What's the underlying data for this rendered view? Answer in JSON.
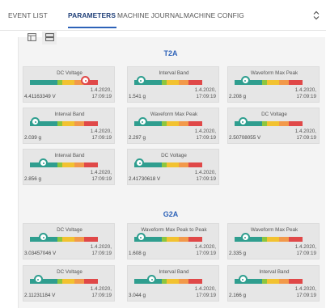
{
  "tabs": [
    {
      "label": "EVENT LIST",
      "active": false
    },
    {
      "label": "PARAMETERS",
      "active": true
    },
    {
      "label": "MACHINE JOURNAL",
      "active": false
    },
    {
      "label": "MACHINE CONFIG",
      "active": false
    }
  ],
  "tabs_scroll_icon": "chevron-up-down-icon",
  "view_buttons": [
    {
      "name": "single-view",
      "icon": "panel-icon",
      "selected": false
    },
    {
      "name": "split-view",
      "icon": "split-rows-icon",
      "selected": true
    }
  ],
  "colors": {
    "accent": "#2d62b8",
    "gauge_green": "#2f9e8f",
    "gauge_lightgreen": "#8cc63f",
    "gauge_yellow": "#f2c230",
    "gauge_orange": "#f2994a",
    "gauge_red": "#e04848",
    "marker_ok": "#2f9e8f",
    "marker_alarm": "#e04848"
  },
  "groups": [
    {
      "title": "T2A",
      "cards": [
        {
          "title": "DC Voltage",
          "value": "4.41163349 V",
          "date": "1.4.2020,",
          "time": "17:09:19",
          "level": 0.82,
          "alarm": true
        },
        {
          "title": "Interval Band",
          "value": "1.541 g",
          "date": "1.4.2020,",
          "time": "17:09:19",
          "level": 0.1,
          "alarm": false
        },
        {
          "title": "Waveform Max Peak",
          "value": "2.208 g",
          "date": "1.4.2020,",
          "time": "17:09:19",
          "level": 0.16,
          "alarm": false
        },
        {
          "title": "Interval Band",
          "value": "2.039 g",
          "date": "1.4.2020,",
          "time": "17:09:19",
          "level": 0.08,
          "alarm": false
        },
        {
          "title": "Waveform Max Peak",
          "value": "2.297 g",
          "date": "1.4.2020,",
          "time": "17:09:19",
          "level": 0.12,
          "alarm": false
        },
        {
          "title": "DC Voltage",
          "value": "2.50708055 V",
          "date": "1.4.2020,",
          "time": "17:09:19",
          "level": 0.12,
          "alarm": false
        },
        {
          "title": "Interval Band",
          "value": "2.856 g",
          "date": "1.4.2020,",
          "time": "17:09:19",
          "level": 0.2,
          "alarm": false
        },
        {
          "title": "DC Voltage",
          "value": "2.41730618 V",
          "date": "1.4.2020,",
          "time": "17:09:19",
          "level": 0.08,
          "alarm": false
        }
      ]
    },
    {
      "title": "G2A",
      "cards": [
        {
          "title": "DC Voltage",
          "value": "3.03457046 V",
          "date": "1.4.2020,",
          "time": "17:09:19",
          "level": 0.2,
          "alarm": false
        },
        {
          "title": "Waveform Max Peak to Peak",
          "value": "1.608 g",
          "date": "1.4.2020,",
          "time": "17:09:19",
          "level": 0.1,
          "alarm": false
        },
        {
          "title": "Waveform Max Peak",
          "value": "2.335 g",
          "date": "1.4.2020,",
          "time": "17:09:19",
          "level": 0.16,
          "alarm": false
        },
        {
          "title": "DC Voltage",
          "value": "2.11231184 V",
          "date": "1.4.2020,",
          "time": "17:09:19",
          "level": 0.12,
          "alarm": false
        },
        {
          "title": "Interval Band",
          "value": "3.044 g",
          "date": "1.4.2020,",
          "time": "17:09:19",
          "level": 0.26,
          "alarm": false
        },
        {
          "title": "Interval Band",
          "value": "2.166 g",
          "date": "1.4.2020,",
          "time": "17:09:19",
          "level": 0.12,
          "alarm": false
        }
      ]
    }
  ]
}
